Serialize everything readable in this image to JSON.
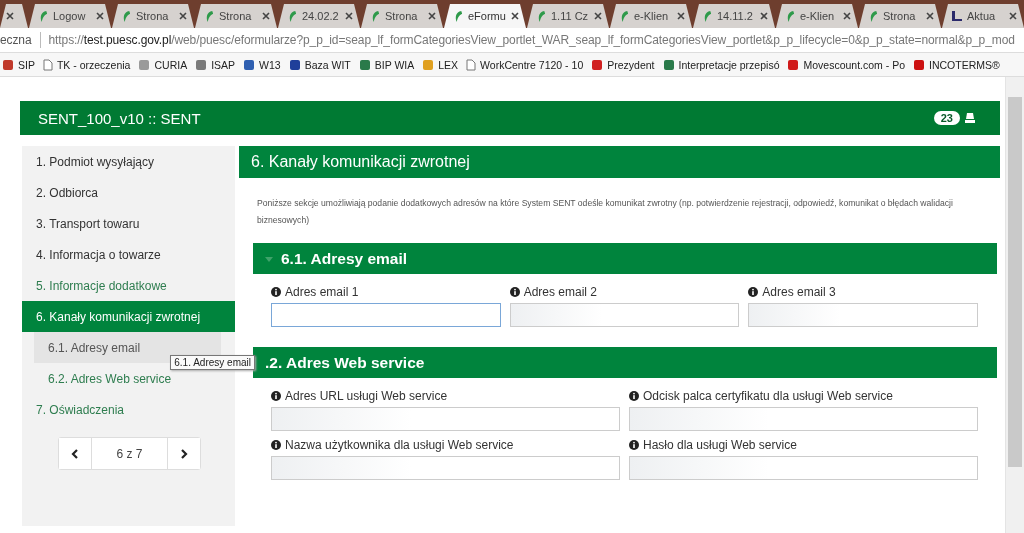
{
  "browser": {
    "tabs": [
      {
        "selected": false
      },
      {
        "title": "Logow",
        "selected": false
      },
      {
        "title": "Strona",
        "selected": false
      },
      {
        "title": "Strona",
        "selected": false
      },
      {
        "title": "24.02.2",
        "selected": false
      },
      {
        "title": "Strona",
        "selected": false
      },
      {
        "title": "eFormu",
        "selected": true
      },
      {
        "title": "1.11 Cz",
        "selected": false
      },
      {
        "title": "e-Klien",
        "selected": false
      },
      {
        "title": "14.11.2",
        "selected": false
      },
      {
        "title": "e-Klien",
        "selected": false
      },
      {
        "title": "Strona",
        "selected": false
      },
      {
        "title": "Aktua",
        "selected": false
      }
    ],
    "address": {
      "prefix": "eczna",
      "scheme": "https://",
      "host": "test.puesc.gov.pl",
      "path": "/web/puesc/eformularze?p_p_id=seap_lf_formCategoriesView_portlet_WAR_seap_lf_formCategoriesView_portlet&p_p_lifecycle=0&p_p_state=normal&p_p_mod"
    },
    "bookmarks": [
      {
        "label": "SIP",
        "kind": "logo"
      },
      {
        "label": "TK - orzeczenia",
        "kind": "page"
      },
      {
        "label": "CURIA",
        "kind": "logo"
      },
      {
        "label": "ISAP",
        "kind": "logo"
      },
      {
        "label": "W13",
        "kind": "logo"
      },
      {
        "label": "Baza WIT",
        "kind": "logo"
      },
      {
        "label": "BIP WIA",
        "kind": "logo"
      },
      {
        "label": "LEX",
        "kind": "logo"
      },
      {
        "label": "WorkCentre 7120 - 10",
        "kind": "page"
      },
      {
        "label": "Prezydent",
        "kind": "logo"
      },
      {
        "label": "Interpretacje przepisó",
        "kind": "logo"
      },
      {
        "label": "Movescount.com - Po",
        "kind": "logo"
      },
      {
        "label": "INCOTERMS®",
        "kind": "logo"
      }
    ]
  },
  "form": {
    "title": "SENT_100_v10 :: SENT",
    "badge": "23",
    "sidebar": {
      "items": [
        {
          "label": "1. Podmiot wysyłający",
          "selected": false,
          "color": "#333333"
        },
        {
          "label": "2. Odbiorca",
          "selected": false,
          "color": "#333333"
        },
        {
          "label": "3. Transport towaru",
          "selected": false,
          "color": "#333333"
        },
        {
          "label": "4. Informacja o towarze",
          "selected": false,
          "color": "#333333"
        },
        {
          "label": "5. Informacje dodatkowe",
          "selected": false,
          "color": "#2e7d4f"
        },
        {
          "label": "6. Kanały komunikacji zwrotnej",
          "selected": true,
          "children": [
            {
              "label": "6.1. Adresy email",
              "selected": false,
              "hovered": true,
              "color": "#555555"
            },
            {
              "label": "6.2. Adres Web service",
              "selected": false,
              "hovered": false,
              "color": "#2e7d4f"
            }
          ]
        },
        {
          "label": "7. Oświadczenia",
          "selected": false,
          "color": "#2e7d4f"
        }
      ],
      "pager": {
        "page": "6 z 7"
      }
    },
    "tooltip": "6.1. Adresy email",
    "section": {
      "title": "6. Kanały komunikacji zwrotnej",
      "description": "Poniższe sekcje umożliwiają podanie dodatkowych adresów na które System SENT odeśle komunikat zwrotny (np. potwierdzenie rejestracji, odpowiedź, komunikat o błędach walidacji biznesowych)",
      "subsections": [
        {
          "title": "6.1. Adresy email",
          "expanded": true,
          "fields": [
            {
              "label": "Adres email 1",
              "focused": true
            },
            {
              "label": "Adres email 2",
              "focused": false
            },
            {
              "label": "Adres email 3",
              "focused": false
            }
          ]
        },
        {
          "title": ".2. Adres Web service",
          "fields": [
            {
              "label": "Adres URL usługi Web service",
              "focused": false
            },
            {
              "label": "Odcisk palca certyfikatu dla usługi Web service",
              "focused": false
            },
            {
              "label": "Nazwa użytkownika dla usługi Web service",
              "focused": false
            },
            {
              "label": "Hasło dla usługi Web service",
              "focused": false
            }
          ]
        }
      ]
    }
  }
}
